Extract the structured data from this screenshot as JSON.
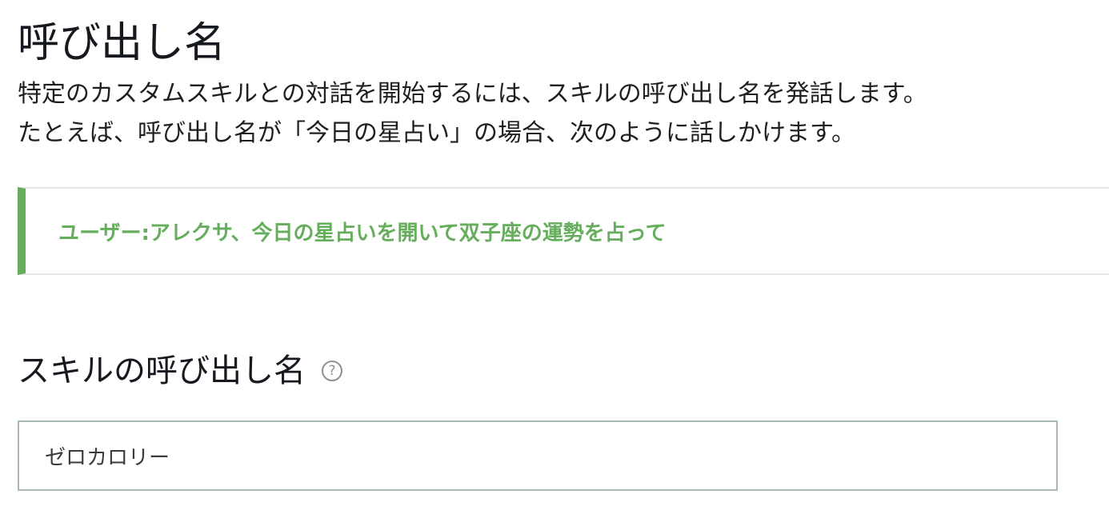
{
  "page": {
    "title": "呼び出し名",
    "description_line1": "特定のカスタムスキルとの対話を開始するには、スキルの呼び出し名を発話します。",
    "description_line2": "たとえば、呼び出し名が「今日の星占い」の場合、次のように話しかけます。"
  },
  "example": {
    "text": "ユーザー:アレクサ、今日の星占いを開いて双子座の運勢を占って",
    "accent_color": "#66ad5d"
  },
  "invocation_field": {
    "label": "スキルの呼び出し名",
    "help_icon": "question-circle-icon",
    "help_glyph": "?",
    "value": "ゼロカロリー"
  }
}
